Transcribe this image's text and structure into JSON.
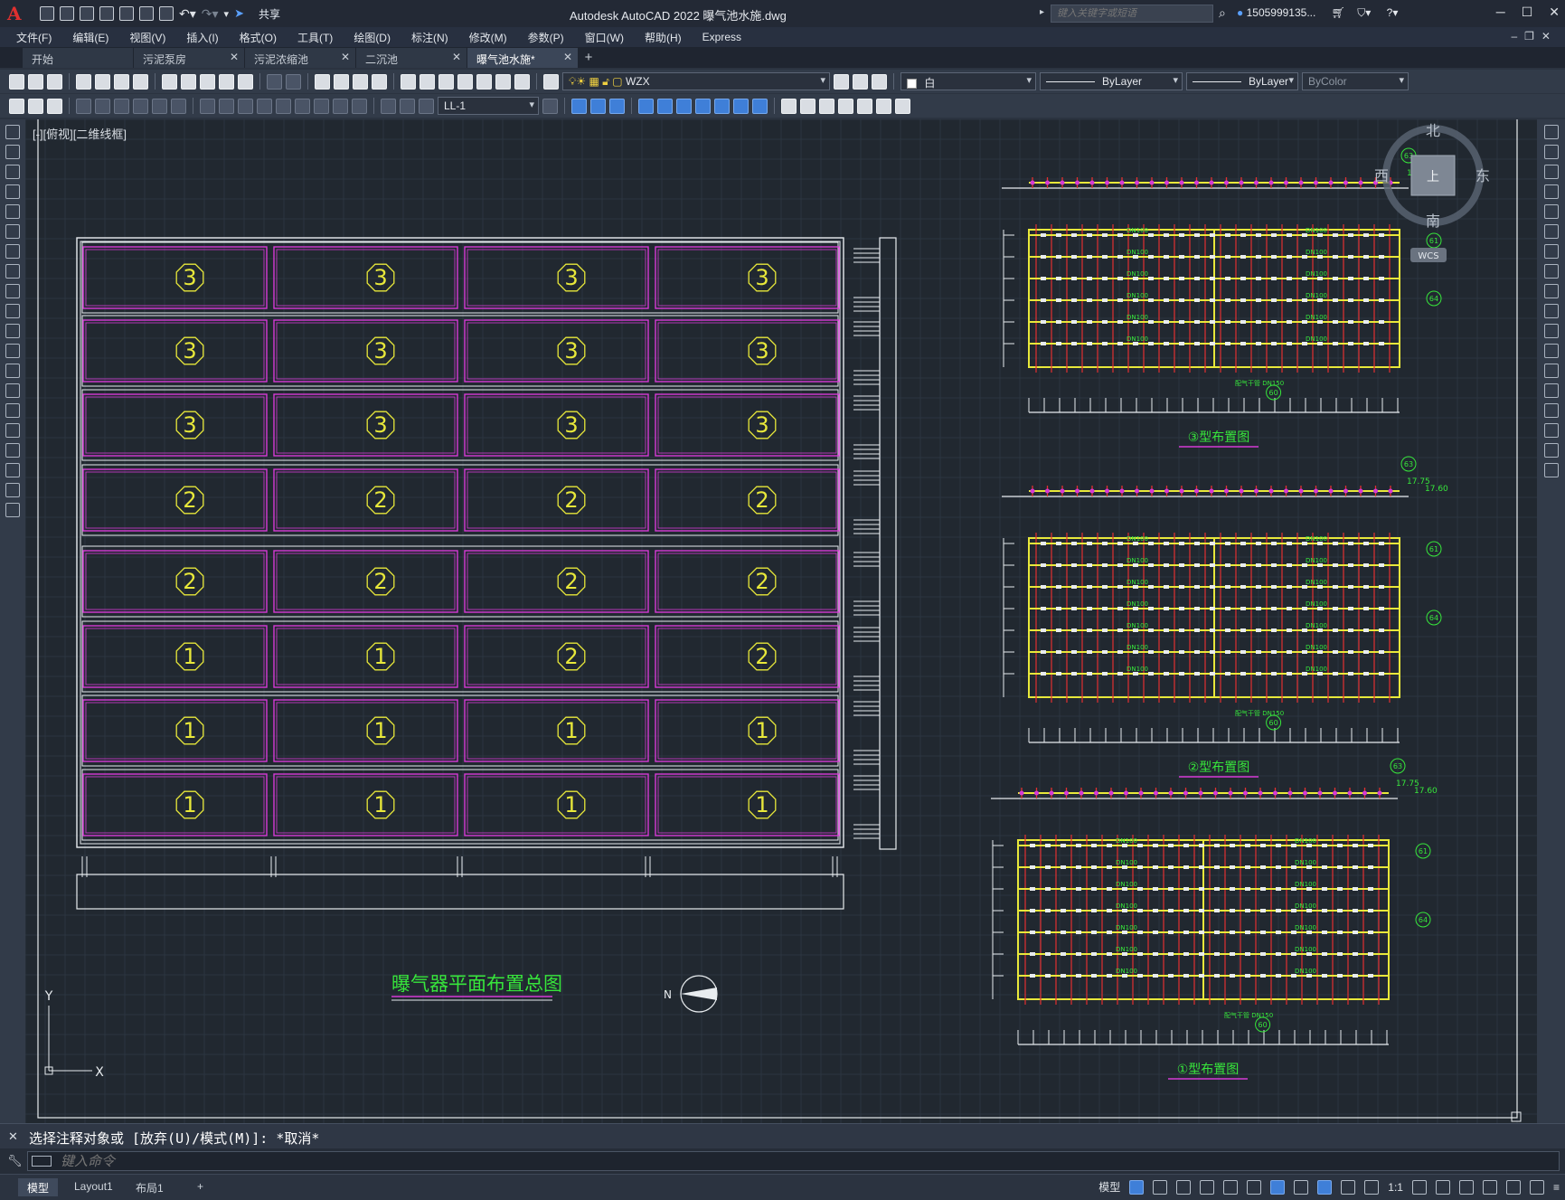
{
  "app": {
    "title": "Autodesk AutoCAD 2022    曝气池水施.dwg",
    "share_label": "共享",
    "search_placeholder": "键入关键字或短语",
    "user_label": "1505999135...",
    "logo_letter": "A"
  },
  "menu": [
    "文件(F)",
    "编辑(E)",
    "视图(V)",
    "插入(I)",
    "格式(O)",
    "工具(T)",
    "绘图(D)",
    "标注(N)",
    "修改(M)",
    "参数(P)",
    "窗口(W)",
    "帮助(H)",
    "Express"
  ],
  "tabs": [
    {
      "label": "开始",
      "active": false,
      "closable": false
    },
    {
      "label": "污泥泵房",
      "active": false,
      "closable": true
    },
    {
      "label": "污泥浓缩池",
      "active": false,
      "closable": true
    },
    {
      "label": "二沉池",
      "active": false,
      "closable": true
    },
    {
      "label": "曝气池水施*",
      "active": true,
      "closable": true
    }
  ],
  "layer": {
    "current": "WZX"
  },
  "properties": {
    "color": "白",
    "linetype": "ByLayer",
    "lineweight": "ByLayer",
    "plotstyle": "ByColor"
  },
  "dimstyle": "LL-1",
  "viewport_label": "[-][俯视][二维线框]",
  "viewcube": {
    "north": "北",
    "south": "南",
    "east": "东",
    "west": "西",
    "top": "上",
    "wcs": "WCS"
  },
  "drawing": {
    "main_title": "曝气器平面布置总图",
    "north_label": "N",
    "grid_rows": [
      [
        "3",
        "3",
        "3",
        "3"
      ],
      [
        "3",
        "3",
        "3",
        "3"
      ],
      [
        "3",
        "3",
        "3",
        "3"
      ],
      [
        "2",
        "2",
        "2",
        "2"
      ],
      [
        "2",
        "2",
        "2",
        "2"
      ],
      [
        "1",
        "1",
        "2",
        "2"
      ],
      [
        "1",
        "1",
        "1",
        "1"
      ],
      [
        "1",
        "1",
        "1",
        "1"
      ]
    ],
    "detail_titles": [
      "③型布置图",
      "②型布置图",
      "①型布置图"
    ],
    "detail_pipe_label": "DN100",
    "detail_main_label": "配气干管 DN150",
    "detail_level_top": "17.75",
    "detail_level_bottom": "17.60",
    "detail_tags": [
      "63",
      "61",
      "64",
      "60"
    ],
    "axis": {
      "y": "Y",
      "x": "X"
    }
  },
  "command": {
    "history": "选择注释对象或 [放弃(U)/模式(M)]: *取消*",
    "placeholder": "键入命令"
  },
  "status": {
    "layouts": [
      {
        "label": "模型",
        "active": true
      },
      {
        "label": "Layout1",
        "active": false
      },
      {
        "label": "布局1",
        "active": false
      }
    ],
    "model_label": "模型",
    "scale": "1:1"
  },
  "colors": {
    "magenta": "#d63ad6",
    "yellow": "#e8e83a",
    "white": "#e8ecef",
    "green": "#37e63b",
    "red": "#e23030",
    "canvas": "#212830"
  }
}
